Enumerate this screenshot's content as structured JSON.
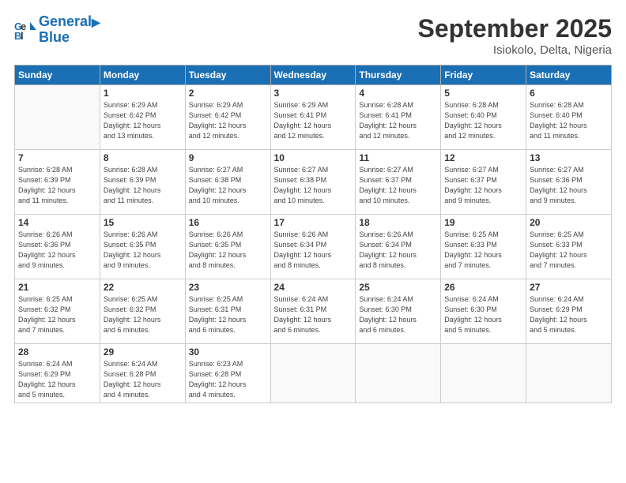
{
  "logo": {
    "line1": "General",
    "line2": "Blue"
  },
  "title": "September 2025",
  "location": "Isiokolo, Delta, Nigeria",
  "days_header": [
    "Sunday",
    "Monday",
    "Tuesday",
    "Wednesday",
    "Thursday",
    "Friday",
    "Saturday"
  ],
  "weeks": [
    [
      {
        "num": "",
        "info": ""
      },
      {
        "num": "1",
        "info": "Sunrise: 6:29 AM\nSunset: 6:42 PM\nDaylight: 12 hours\nand 13 minutes."
      },
      {
        "num": "2",
        "info": "Sunrise: 6:29 AM\nSunset: 6:42 PM\nDaylight: 12 hours\nand 12 minutes."
      },
      {
        "num": "3",
        "info": "Sunrise: 6:29 AM\nSunset: 6:41 PM\nDaylight: 12 hours\nand 12 minutes."
      },
      {
        "num": "4",
        "info": "Sunrise: 6:28 AM\nSunset: 6:41 PM\nDaylight: 12 hours\nand 12 minutes."
      },
      {
        "num": "5",
        "info": "Sunrise: 6:28 AM\nSunset: 6:40 PM\nDaylight: 12 hours\nand 12 minutes."
      },
      {
        "num": "6",
        "info": "Sunrise: 6:28 AM\nSunset: 6:40 PM\nDaylight: 12 hours\nand 11 minutes."
      }
    ],
    [
      {
        "num": "7",
        "info": "Sunrise: 6:28 AM\nSunset: 6:39 PM\nDaylight: 12 hours\nand 11 minutes."
      },
      {
        "num": "8",
        "info": "Sunrise: 6:28 AM\nSunset: 6:39 PM\nDaylight: 12 hours\nand 11 minutes."
      },
      {
        "num": "9",
        "info": "Sunrise: 6:27 AM\nSunset: 6:38 PM\nDaylight: 12 hours\nand 10 minutes."
      },
      {
        "num": "10",
        "info": "Sunrise: 6:27 AM\nSunset: 6:38 PM\nDaylight: 12 hours\nand 10 minutes."
      },
      {
        "num": "11",
        "info": "Sunrise: 6:27 AM\nSunset: 6:37 PM\nDaylight: 12 hours\nand 10 minutes."
      },
      {
        "num": "12",
        "info": "Sunrise: 6:27 AM\nSunset: 6:37 PM\nDaylight: 12 hours\nand 9 minutes."
      },
      {
        "num": "13",
        "info": "Sunrise: 6:27 AM\nSunset: 6:36 PM\nDaylight: 12 hours\nand 9 minutes."
      }
    ],
    [
      {
        "num": "14",
        "info": "Sunrise: 6:26 AM\nSunset: 6:36 PM\nDaylight: 12 hours\nand 9 minutes."
      },
      {
        "num": "15",
        "info": "Sunrise: 6:26 AM\nSunset: 6:35 PM\nDaylight: 12 hours\nand 9 minutes."
      },
      {
        "num": "16",
        "info": "Sunrise: 6:26 AM\nSunset: 6:35 PM\nDaylight: 12 hours\nand 8 minutes."
      },
      {
        "num": "17",
        "info": "Sunrise: 6:26 AM\nSunset: 6:34 PM\nDaylight: 12 hours\nand 8 minutes."
      },
      {
        "num": "18",
        "info": "Sunrise: 6:26 AM\nSunset: 6:34 PM\nDaylight: 12 hours\nand 8 minutes."
      },
      {
        "num": "19",
        "info": "Sunrise: 6:25 AM\nSunset: 6:33 PM\nDaylight: 12 hours\nand 7 minutes."
      },
      {
        "num": "20",
        "info": "Sunrise: 6:25 AM\nSunset: 6:33 PM\nDaylight: 12 hours\nand 7 minutes."
      }
    ],
    [
      {
        "num": "21",
        "info": "Sunrise: 6:25 AM\nSunset: 6:32 PM\nDaylight: 12 hours\nand 7 minutes."
      },
      {
        "num": "22",
        "info": "Sunrise: 6:25 AM\nSunset: 6:32 PM\nDaylight: 12 hours\nand 6 minutes."
      },
      {
        "num": "23",
        "info": "Sunrise: 6:25 AM\nSunset: 6:31 PM\nDaylight: 12 hours\nand 6 minutes."
      },
      {
        "num": "24",
        "info": "Sunrise: 6:24 AM\nSunset: 6:31 PM\nDaylight: 12 hours\nand 6 minutes."
      },
      {
        "num": "25",
        "info": "Sunrise: 6:24 AM\nSunset: 6:30 PM\nDaylight: 12 hours\nand 6 minutes."
      },
      {
        "num": "26",
        "info": "Sunrise: 6:24 AM\nSunset: 6:30 PM\nDaylight: 12 hours\nand 5 minutes."
      },
      {
        "num": "27",
        "info": "Sunrise: 6:24 AM\nSunset: 6:29 PM\nDaylight: 12 hours\nand 5 minutes."
      }
    ],
    [
      {
        "num": "28",
        "info": "Sunrise: 6:24 AM\nSunset: 6:29 PM\nDaylight: 12 hours\nand 5 minutes."
      },
      {
        "num": "29",
        "info": "Sunrise: 6:24 AM\nSunset: 6:28 PM\nDaylight: 12 hours\nand 4 minutes."
      },
      {
        "num": "30",
        "info": "Sunrise: 6:23 AM\nSunset: 6:28 PM\nDaylight: 12 hours\nand 4 minutes."
      },
      {
        "num": "",
        "info": ""
      },
      {
        "num": "",
        "info": ""
      },
      {
        "num": "",
        "info": ""
      },
      {
        "num": "",
        "info": ""
      }
    ]
  ]
}
